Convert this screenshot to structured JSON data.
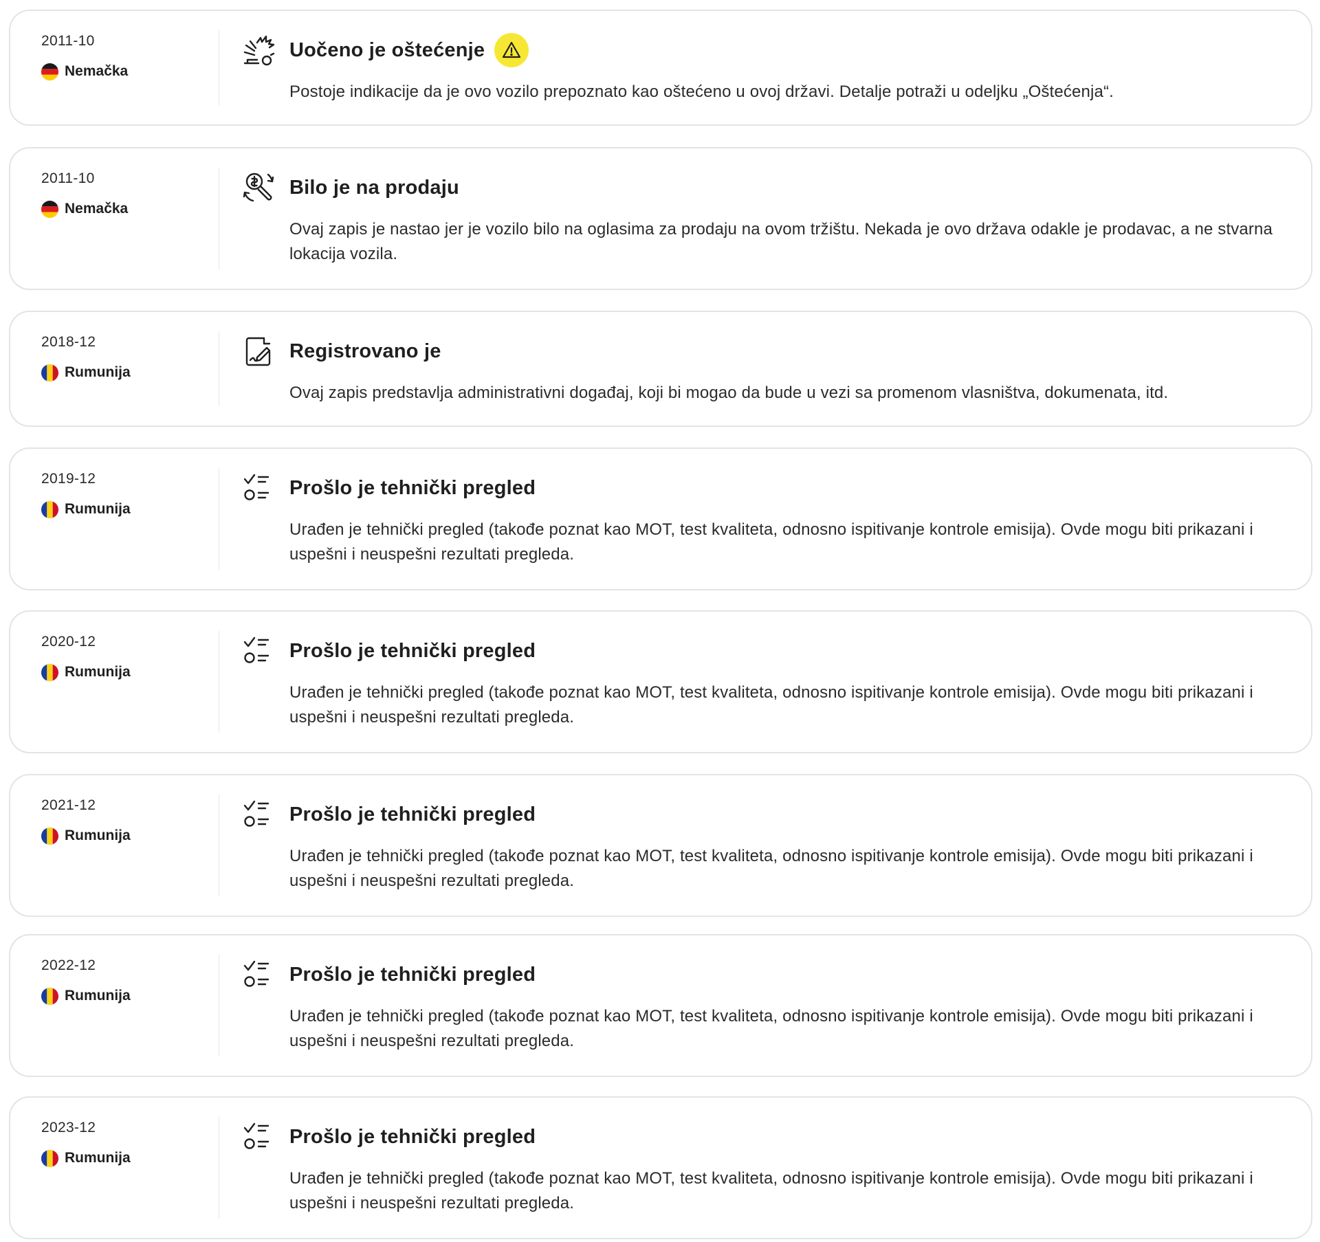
{
  "colors": {
    "warning_badge": "#f7e735",
    "border": "#e4e4e4",
    "text": "#1f1f1f"
  },
  "events": [
    {
      "date": "2011-10",
      "country": "Nemačka",
      "flag": "germany-flag",
      "icon": "damage-crash-icon",
      "title": "Uočeno je oštećenje",
      "warning": true,
      "description": "Postoje indikacije da je ovo vozilo prepoznato kao oštećeno u ovoj državi. Detalje potraži u odeljku „Oštećenja“."
    },
    {
      "date": "2011-10",
      "country": "Nemačka",
      "flag": "germany-flag",
      "icon": "for-sale-icon",
      "title": "Bilo je na prodaju",
      "warning": false,
      "description": "Ovaj zapis je nastao jer je vozilo bilo na oglasima za prodaju na ovom tržištu. Nekada je ovo država odakle je prodavac, a ne stvarna lokacija vozila."
    },
    {
      "date": "2018-12",
      "country": "Rumunija",
      "flag": "romania-flag",
      "icon": "registration-document-icon",
      "title": "Registrovano je",
      "warning": false,
      "description": "Ovaj zapis predstavlja administrativni događaj, koji bi mogao da bude u vezi sa promenom vlasništva, dokumenata, itd."
    },
    {
      "date": "2019-12",
      "country": "Rumunija",
      "flag": "romania-flag",
      "icon": "checklist-icon",
      "title": "Prošlo je tehnički pregled",
      "warning": false,
      "description": "Urađen je tehnički pregled (takođe poznat kao MOT, test kvaliteta, odnosno ispitivanje kontrole emisija). Ovde mogu biti prikazani i uspešni i neuspešni rezultati pregleda."
    },
    {
      "date": "2020-12",
      "country": "Rumunija",
      "flag": "romania-flag",
      "icon": "checklist-icon",
      "title": "Prošlo je tehnički pregled",
      "warning": false,
      "description": "Urađen je tehnički pregled (takođe poznat kao MOT, test kvaliteta, odnosno ispitivanje kontrole emisija). Ovde mogu biti prikazani i uspešni i neuspešni rezultati pregleda."
    },
    {
      "date": "2021-12",
      "country": "Rumunija",
      "flag": "romania-flag",
      "icon": "checklist-icon",
      "title": "Prošlo je tehnički pregled",
      "warning": false,
      "description": "Urađen je tehnički pregled (takođe poznat kao MOT, test kvaliteta, odnosno ispitivanje kontrole emisija). Ovde mogu biti prikazani i uspešni i neuspešni rezultati pregleda."
    },
    {
      "date": "2022-12",
      "country": "Rumunija",
      "flag": "romania-flag",
      "icon": "checklist-icon",
      "title": "Prošlo je tehnički pregled",
      "warning": false,
      "description": "Urađen je tehnički pregled (takođe poznat kao MOT, test kvaliteta, odnosno ispitivanje kontrole emisija). Ovde mogu biti prikazani i uspešni i neuspešni rezultati pregleda."
    },
    {
      "date": "2023-12",
      "country": "Rumunija",
      "flag": "romania-flag",
      "icon": "checklist-icon",
      "title": "Prošlo je tehnički pregled",
      "warning": false,
      "description": "Urađen je tehnički pregled (takođe poznat kao MOT, test kvaliteta, odnosno ispitivanje kontrole emisija). Ovde mogu biti prikazani i uspešni i neuspešni rezultati pregleda."
    }
  ]
}
